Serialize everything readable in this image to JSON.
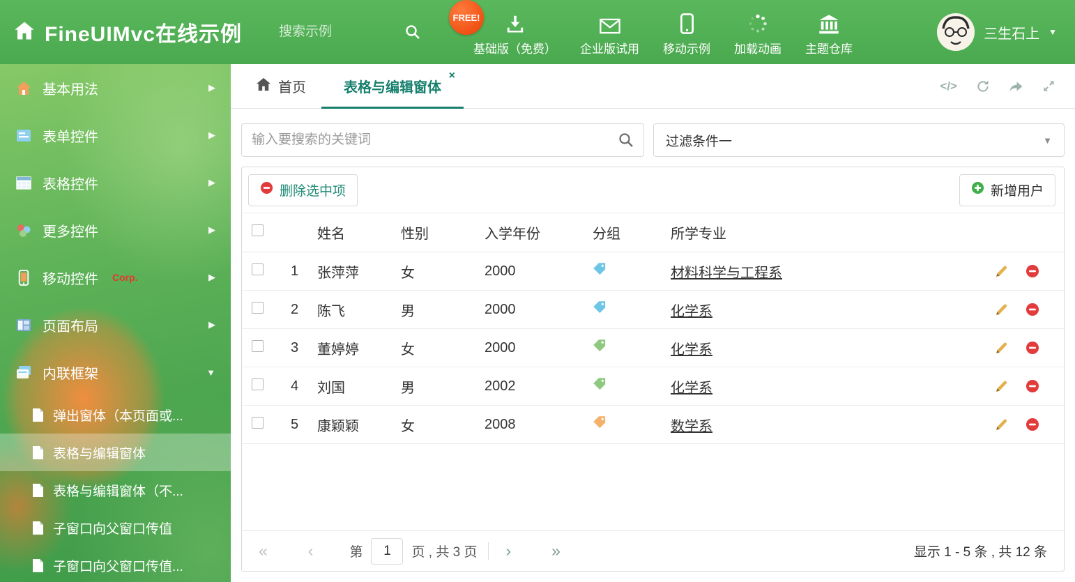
{
  "header": {
    "title": "FineUIMvc在线示例",
    "search_placeholder": "搜索示例",
    "nav": [
      {
        "label": "基础版（免费）",
        "icon": "download-icon",
        "badge": "FREE!"
      },
      {
        "label": "企业版试用",
        "icon": "envelope-icon"
      },
      {
        "label": "移动示例",
        "icon": "mobile-icon"
      },
      {
        "label": "加载动画",
        "icon": "spinner-icon"
      },
      {
        "label": "主题仓库",
        "icon": "bank-icon"
      }
    ],
    "user": {
      "name": "三生石上"
    }
  },
  "sidebar": {
    "items": [
      {
        "label": "基本用法",
        "icon": "home-icon"
      },
      {
        "label": "表单控件",
        "icon": "form-icon"
      },
      {
        "label": "表格控件",
        "icon": "table-icon"
      },
      {
        "label": "更多控件",
        "icon": "widgets-icon"
      },
      {
        "label": "移动控件",
        "badge": "Corp.",
        "icon": "mobile-icon"
      },
      {
        "label": "页面布局",
        "icon": "layout-icon"
      },
      {
        "label": "内联框架",
        "icon": "iframe-icon"
      }
    ],
    "subitems": [
      {
        "label": "弹出窗体（本页面或..."
      },
      {
        "label": "表格与编辑窗体"
      },
      {
        "label": "表格与编辑窗体（不..."
      },
      {
        "label": "子窗口向父窗口传值"
      },
      {
        "label": "子窗口向父窗口传值..."
      }
    ]
  },
  "tabs": {
    "home_label": "首页",
    "active_label": "表格与编辑窗体"
  },
  "filter": {
    "search_placeholder": "输入要搜索的关键词",
    "dropdown_value": "过滤条件一"
  },
  "grid": {
    "toolbar": {
      "delete_label": "删除选中项",
      "add_label": "新增用户"
    },
    "columns": [
      "姓名",
      "性别",
      "入学年份",
      "分组",
      "所学专业"
    ],
    "rows": [
      {
        "index": "1",
        "name": "张萍萍",
        "gender": "女",
        "year": "2000",
        "tag_color": "#6ec6e6",
        "major": "材料科学与工程系"
      },
      {
        "index": "2",
        "name": "陈飞",
        "gender": "男",
        "year": "2000",
        "tag_color": "#6ec6e6",
        "major": "化学系"
      },
      {
        "index": "3",
        "name": "董婷婷",
        "gender": "女",
        "year": "2000",
        "tag_color": "#8fc97f",
        "major": "化学系"
      },
      {
        "index": "4",
        "name": "刘国",
        "gender": "男",
        "year": "2002",
        "tag_color": "#8fc97f",
        "major": "化学系"
      },
      {
        "index": "5",
        "name": "康颖颖",
        "gender": "女",
        "year": "2008",
        "tag_color": "#f5b06c",
        "major": "数学系"
      }
    ],
    "pagination": {
      "first": "«",
      "prev": "‹",
      "next": "›",
      "last": "»",
      "page_prefix": "第",
      "current_page": "1",
      "page_suffix": "页 , 共 3 页",
      "summary": "显示 1 - 5 条 , 共 12 条"
    }
  },
  "icons": {
    "caret_down": "▼",
    "arrow_right": "▶",
    "close": "×",
    "code_glyph": "</>"
  },
  "colors": {
    "accent": "#17806d",
    "header_green": "#4faf52",
    "danger": "#e23b3b",
    "success": "#3fae49",
    "pencil": "#e3b04b",
    "free_badge": "#ef4f12"
  }
}
